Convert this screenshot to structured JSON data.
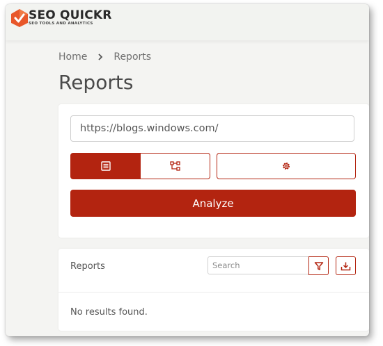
{
  "brand": {
    "name": "SEO QUICKR",
    "tagline": "SEO TOOLS AND ANALYTICS",
    "color": "#e8572a"
  },
  "breadcrumb": {
    "home": "Home",
    "current": "Reports"
  },
  "page": {
    "title": "Reports"
  },
  "analyzer": {
    "url_value": "https://blogs.windows.com/",
    "view_buttons": [
      {
        "icon": "list-icon",
        "active": true
      },
      {
        "icon": "sitemap-icon",
        "active": false
      }
    ],
    "settings_icon": "gear-icon",
    "analyze_label": "Analyze"
  },
  "reports_panel": {
    "label": "Reports",
    "search_placeholder": "Search",
    "filter_icon": "filter-icon",
    "download_icon": "download-icon",
    "empty_message": "No results found."
  },
  "colors": {
    "accent": "#b32410",
    "background": "#f4f4f2"
  }
}
